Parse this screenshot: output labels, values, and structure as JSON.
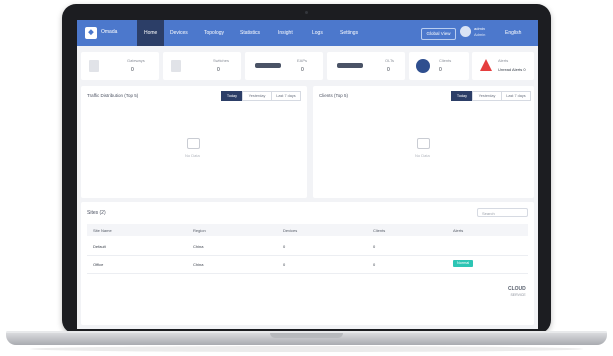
{
  "topbar": {
    "logo_text": "Omada",
    "nav": [
      "Home",
      "Devices",
      "Topology",
      "Statistics",
      "Insight",
      "Logs",
      "Settings"
    ],
    "button": "Global View",
    "user_name": "admin",
    "user_role": "Admin",
    "language": "English"
  },
  "stats": [
    {
      "label": "Gateways",
      "value": "0"
    },
    {
      "label": "Switches",
      "value": "0"
    },
    {
      "label": "EAPs",
      "value": "0"
    },
    {
      "label": "OLTs",
      "value": "0"
    },
    {
      "label": "Clients",
      "value": "0"
    },
    {
      "label": "Alerts",
      "value": "Unread Alerts 0"
    }
  ],
  "panels": [
    {
      "title": "Traffic Distribution (Top 5)",
      "segments": [
        "Today",
        "Yesterday",
        "Last 7 days"
      ],
      "empty": "No Data"
    },
    {
      "title": "Clients (Top 5)",
      "segments": [
        "Today",
        "Yesterday",
        "Last 7 days"
      ],
      "empty": "No Data"
    }
  ],
  "table": {
    "title": "Sites (2)",
    "search_placeholder": "Search",
    "columns": [
      "Site Name",
      "Region",
      "Devices",
      "Clients",
      "Alerts"
    ],
    "rows": [
      {
        "name": "Default",
        "region": "China",
        "devices": "0",
        "clients": "0",
        "badge": ""
      },
      {
        "name": "Office",
        "region": "China",
        "devices": "0",
        "clients": "0",
        "badge": "Normal"
      }
    ]
  },
  "watermark": {
    "line1": "CLOUD",
    "line2": "SERVICE"
  },
  "colors": {
    "topbar": "#4c78cc",
    "nav_active": "#2c3e67",
    "alert": "#e53e3e",
    "badge": "#2dc5b4"
  }
}
